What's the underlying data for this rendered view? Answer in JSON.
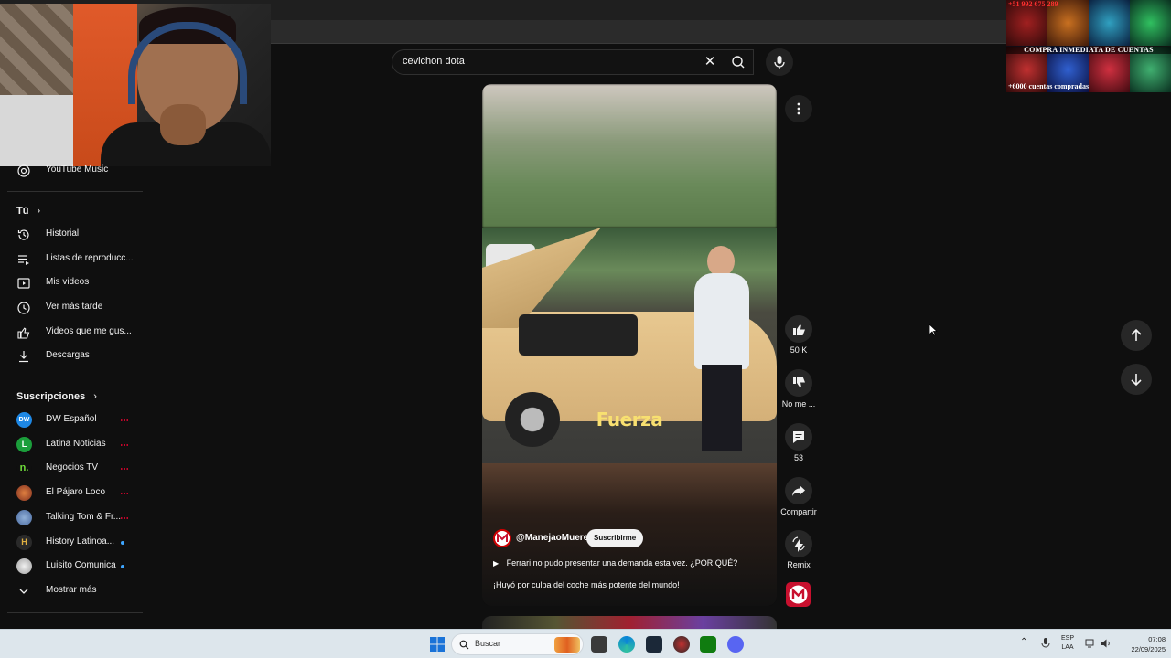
{
  "search": {
    "query": "cevichon dota"
  },
  "ad": {
    "phone": "+51 992 675 289",
    "headline": "COMPRA INMEDIATA DE CUENTAS",
    "subline": "+6000 cuentas compradas"
  },
  "sidebar": {
    "top_item": "YouTube Music",
    "you_heading": "Tú",
    "you_items": [
      {
        "label": "Historial",
        "icon": "history-icon"
      },
      {
        "label": "Listas de reproducc...",
        "icon": "playlists-icon"
      },
      {
        "label": "Mis videos",
        "icon": "my-videos-icon"
      },
      {
        "label": "Ver más tarde",
        "icon": "watch-later-icon"
      },
      {
        "label": "Videos que me gus...",
        "icon": "liked-videos-icon"
      },
      {
        "label": "Descargas",
        "icon": "downloads-icon"
      }
    ],
    "subs_heading": "Suscripciones",
    "subscriptions": [
      {
        "label": "DW Español",
        "badge": "live",
        "color": "#1e88e5",
        "initial": "DW"
      },
      {
        "label": "Latina Noticias",
        "badge": "live",
        "color": "#1b9e3b",
        "initial": "L"
      },
      {
        "label": "Negocios TV",
        "badge": "live",
        "color": "#0f0f0f",
        "initial": "n."
      },
      {
        "label": "El Pájaro Loco",
        "badge": "live",
        "color": "#b04a2a",
        "initial": ""
      },
      {
        "label": "Talking Tom & Fr...",
        "badge": "live",
        "color": "#5a7ab0",
        "initial": ""
      },
      {
        "label": "History Latinoa...",
        "badge": "new",
        "color": "#3a3a3a",
        "initial": "H"
      },
      {
        "label": "Luisito Comunica",
        "badge": "new",
        "color": "#d8d8d8",
        "initial": ""
      }
    ],
    "show_more": "Mostrar más"
  },
  "short": {
    "overlay_caption": "Fuerza",
    "channel": "@ManejaoMuere",
    "subscribe_label": "Suscribirme",
    "title": "Ferrari no pudo presentar una demanda esta vez. ¿POR QUÉ?",
    "description": "¡Huyó por culpa del coche más potente del mundo!"
  },
  "actions": {
    "like_count": "50 K",
    "dislike_label": "No me ...",
    "comments_count": "53",
    "share_label": "Compartir",
    "remix_label": "Remix"
  },
  "taskbar": {
    "search_label": "Buscar",
    "lang_top": "ESP",
    "lang_bottom": "LAA",
    "time": "07:08",
    "date": "22/09/2025"
  },
  "colors": {
    "background": "#0f0f0f",
    "live_badge": "#ff0033",
    "new_dot": "#3ea6ff",
    "caption_yellow": "#f8e070"
  }
}
